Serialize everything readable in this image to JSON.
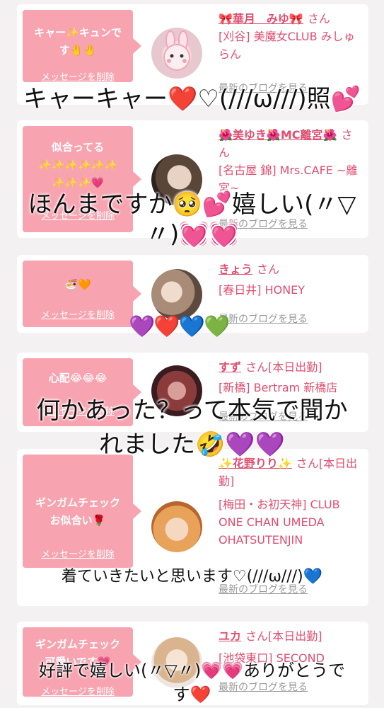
{
  "cards": [
    {
      "message": "キャー✨キュンです🤚🤚",
      "delete_label": "メッセージを削除",
      "name": "🎀華月　みゆ🎀",
      "san": "さん",
      "shop": "[刈谷] 美魔女CLUB みしゅらん",
      "blog_label": "最新のブログを見る"
    },
    {
      "message": "似合ってる\n✨✨✨✨✨✨\n✨✨✨💗",
      "delete_label": "メッセージを削除",
      "name": "🌺美ゆき🌺MC離宮🌺",
      "san": "さん",
      "shop": "[名古屋 錦] Mrs.CAFE ~離宮~",
      "blog_label": "最新のブログを見る"
    },
    {
      "message": "🍜🧡",
      "delete_label": "メッセージを削除",
      "name": "きょう",
      "san": "さん",
      "shop": "[春日井] HONEY",
      "blog_label": "最新のブログを見る"
    },
    {
      "message": "心配😂😂😂",
      "delete_label": "メッセージを削除",
      "name": "すず",
      "san": "さん[本日出勤]",
      "shop": "[新橋] Bertram 新橋店",
      "blog_label": "最新のブログを見る"
    },
    {
      "message": "ギンガムチェック\nお似合い🌹",
      "delete_label": "メッセージを削除",
      "name": "✨花野りり✨",
      "san": "さん[本日出勤]",
      "shop": "[梅田・お初天神] CLUB ONE CHAN UMEDA OHATSUTENJIN",
      "blog_label": "最新のブログを見る"
    },
    {
      "message": "ギンガムチェック\n可愛いです💗",
      "delete_label": "メッセージを削除",
      "name": "ユカ",
      "san": "さん[本日出勤]",
      "shop": "[池袋東口] SECOND",
      "blog_label": "最新のブログを見る"
    }
  ],
  "overlays": {
    "caption1": "キャーキャー❤️♡(///ω///)照💕",
    "caption2_line1": "ほんまですか🥺💕嬉しい(〃▽",
    "caption2_line2": "〃)💓💓",
    "hearts": "💜❤️💙💚",
    "caption3_line1": "何かあった？って本気で聞か",
    "caption3_line2": "れました🤣💜💜",
    "caption4": "着ていきたいと思います♡(///ω///)💙",
    "caption5_line1": "好評で嬉しい(〃▽〃)💗💗ありがとうで",
    "caption5_line2": "す❤️"
  },
  "colors": {
    "accent": "#e04e6f",
    "bubble": "#f7a3b0",
    "background": "#f3f1f2"
  }
}
